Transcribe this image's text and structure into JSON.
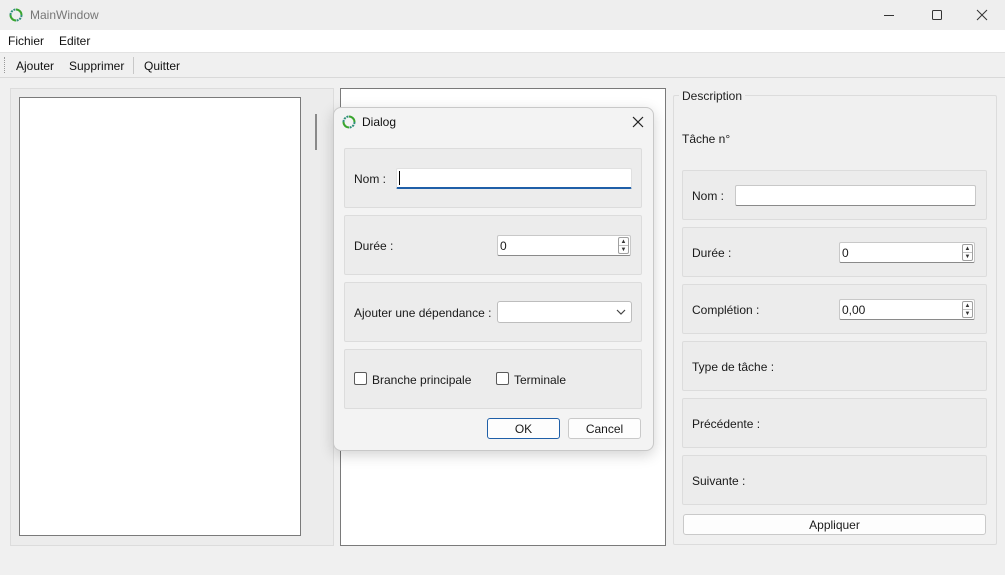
{
  "window": {
    "title": "MainWindow",
    "app_icon": "qt-ring-icon",
    "controls": [
      "minimize-icon",
      "maximize-icon",
      "close-icon"
    ]
  },
  "menubar": {
    "items": [
      {
        "label": "Fichier"
      },
      {
        "label": "Editer"
      }
    ]
  },
  "toolbar": {
    "ajouter_label": "Ajouter",
    "supprimer_label": "Supprimer",
    "quitter_label": "Quitter"
  },
  "description": {
    "title": "Description",
    "task_number_label": "Tâche n°",
    "nom_label": "Nom :",
    "nom_value": "",
    "duree_label": "Durée :",
    "duree_value": "0",
    "completion_label": "Complétion :",
    "completion_value": "0,00",
    "type_label": "Type de tâche :",
    "precedente_label": "Précédente :",
    "suivante_label": "Suivante :",
    "apply_label": "Appliquer"
  },
  "dialog": {
    "title": "Dialog",
    "nom_label": "Nom :",
    "nom_value": "",
    "duree_label": "Durée :",
    "duree_value": "0",
    "dependance_label": "Ajouter une dépendance :",
    "dependance_selected": "",
    "branche_label": "Branche principale",
    "branche_checked": false,
    "terminale_label": "Terminale",
    "terminale_checked": false,
    "ok_label": "OK",
    "cancel_label": "Cancel"
  },
  "colors": {
    "accent": "#1f5fa8",
    "icon_green": "#3aa52f"
  }
}
